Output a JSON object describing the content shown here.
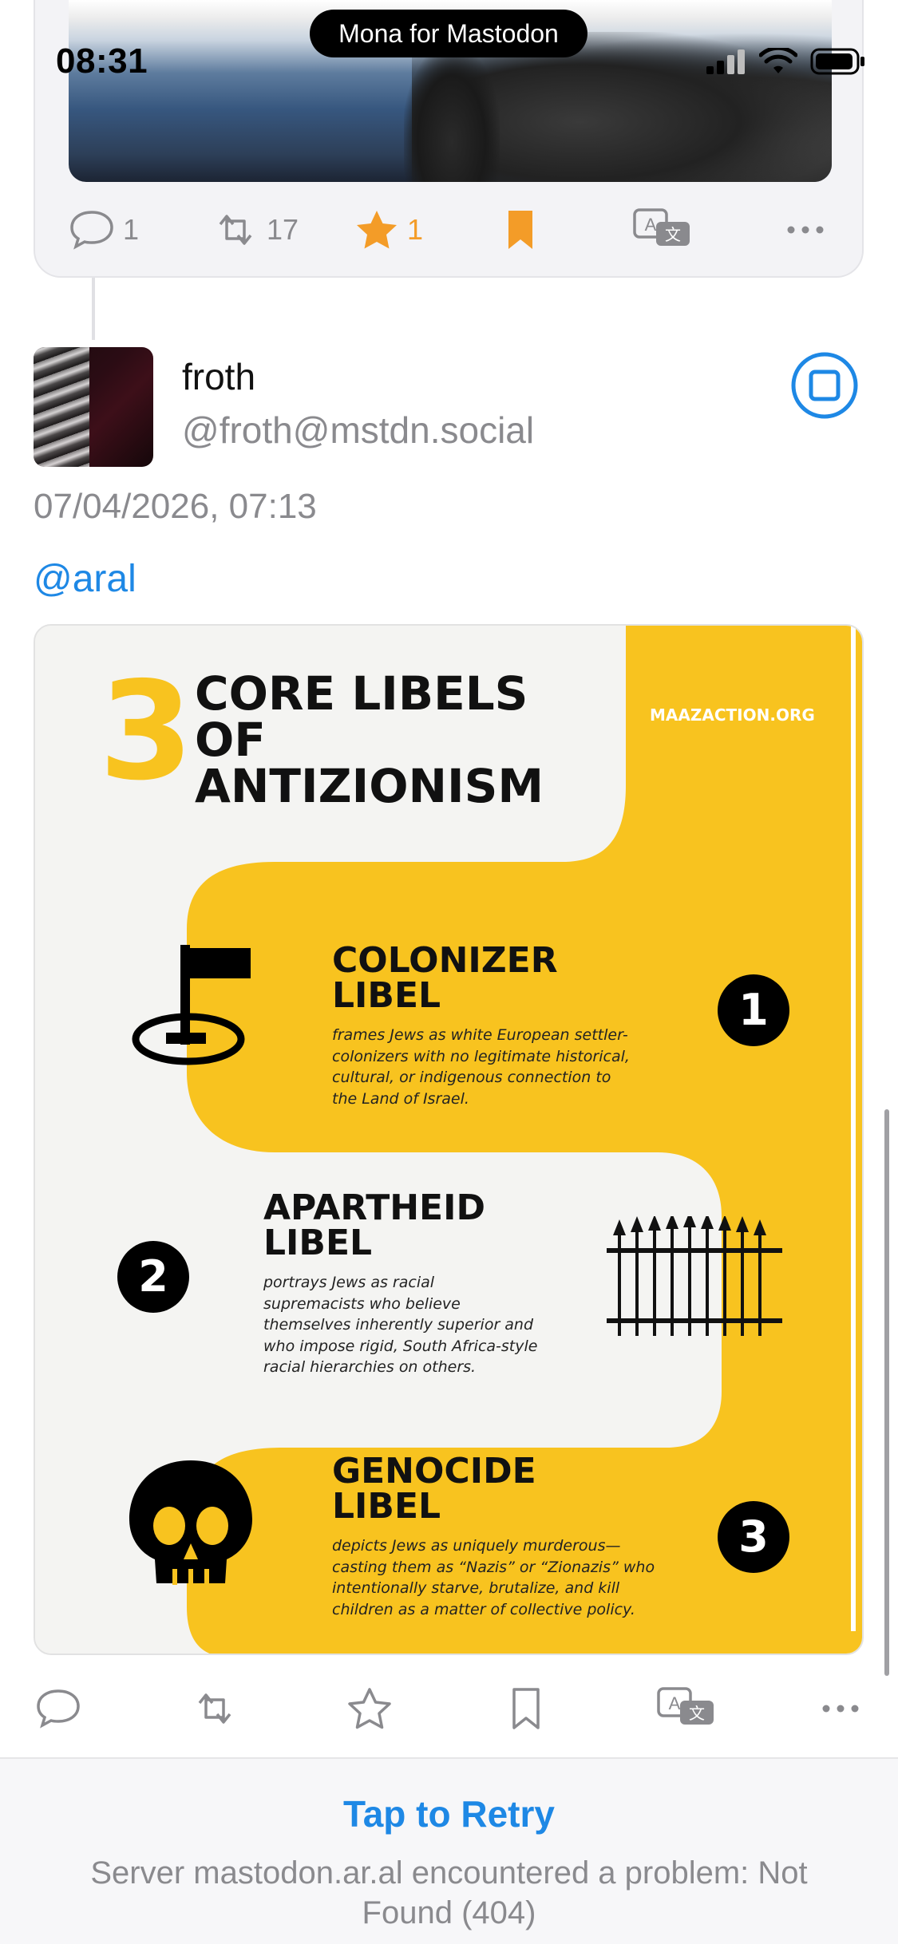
{
  "status_bar": {
    "time": "08:31",
    "app_name": "Mona for Mastodon"
  },
  "previous_post": {
    "replies": "1",
    "boosts": "17",
    "favourites": "1"
  },
  "post": {
    "display_name": "froth",
    "handle": "@froth@mstdn.social",
    "timestamp": "07/04/2026, 07:13",
    "mention": "@aral"
  },
  "infographic": {
    "number": "3",
    "title_line1": "CORE LIBELS",
    "title_line2": "OF",
    "title_line3": "ANTIZIONISM",
    "site": "MAAZACTION.ORG",
    "items": [
      {
        "num": "1",
        "title1": "COLONIZER",
        "title2": "LIBEL",
        "body": [
          "frames Jews as white European settler-",
          "colonizers with no legitimate historical,",
          "cultural, or indigenous connection to",
          "the Land of Israel."
        ]
      },
      {
        "num": "2",
        "title1": "APARTHEID",
        "title2": "LIBEL",
        "body": [
          "portrays Jews as racial",
          "supremacists who believe",
          "themselves inherently superior and",
          "who impose rigid, South Africa-style",
          "racial hierarchies on others."
        ]
      },
      {
        "num": "3",
        "title1": "GENOCIDE",
        "title2": "LIBEL",
        "body": [
          "depicts Jews as uniquely murderous—",
          "casting them as “Nazis” or “Zionazis” who",
          "intentionally starve, brutalize, and kill",
          "children as a matter of collective policy."
        ]
      }
    ]
  },
  "footer": {
    "retry_label": "Tap to Retry",
    "error_text": "Server mastodon.ar.al encountered a problem: Not Found (404)"
  },
  "colors": {
    "accent": "#1e88e5",
    "favourite": "#f39c28",
    "infographic_yellow": "#f8c31f"
  }
}
